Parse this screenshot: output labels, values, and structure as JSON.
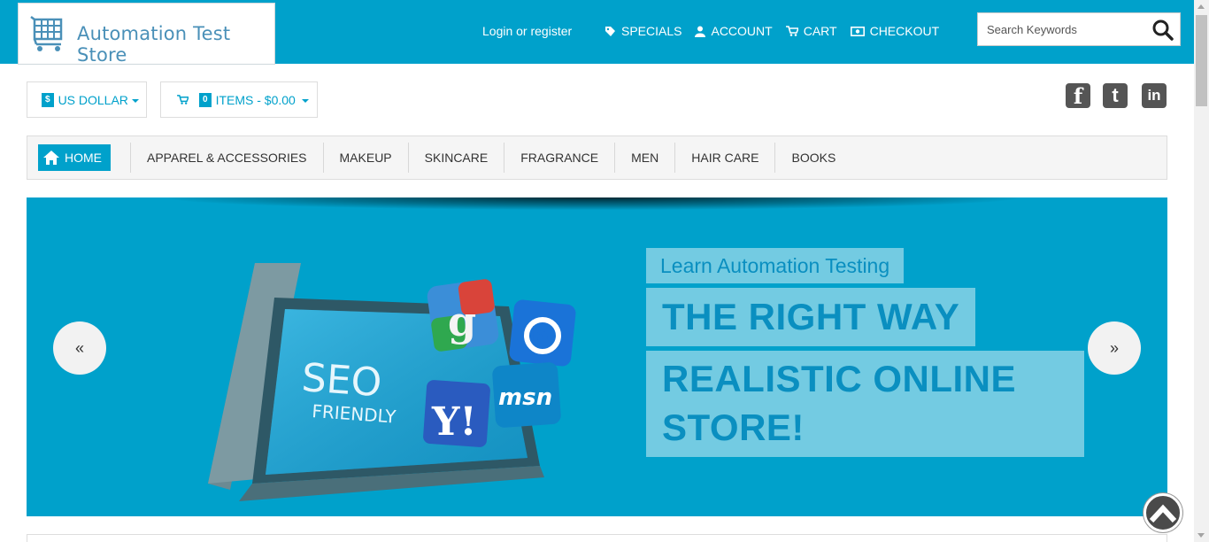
{
  "header": {
    "logo_text": "Automation Test Store",
    "login_link": "Login or register",
    "nav": [
      {
        "label": "SPECIALS",
        "icon": "tag-icon"
      },
      {
        "label": "ACCOUNT",
        "icon": "user-icon"
      },
      {
        "label": "CART",
        "icon": "cart-icon"
      },
      {
        "label": "CHECKOUT",
        "icon": "money-icon"
      }
    ],
    "search_placeholder": "Search Keywords"
  },
  "currency": {
    "symbol": "$",
    "label": "US DOLLAR"
  },
  "mini_cart": {
    "count": "0",
    "label": "ITEMS - $0.00"
  },
  "social": [
    {
      "name": "facebook",
      "glyph": "f"
    },
    {
      "name": "twitter",
      "glyph": "t"
    },
    {
      "name": "linkedin",
      "glyph": "in"
    }
  ],
  "categories": {
    "home": "HOME",
    "items": [
      "APPAREL & ACCESSORIES",
      "MAKEUP",
      "SKINCARE",
      "FRAGRANCE",
      "MEN",
      "HAIR CARE",
      "BOOKS"
    ]
  },
  "banner": {
    "caption_small": "Learn Automation Testing",
    "caption_line": "THE RIGHT WAY",
    "caption_big": "REALISTIC ONLINE STORE!",
    "screen_text_1": "SEO",
    "screen_text_2": "FRIENDLY",
    "prev_glyph": "«",
    "next_glyph": "»"
  },
  "colors": {
    "brand": "#00a1cb",
    "caption_text": "#0a8fc0"
  }
}
